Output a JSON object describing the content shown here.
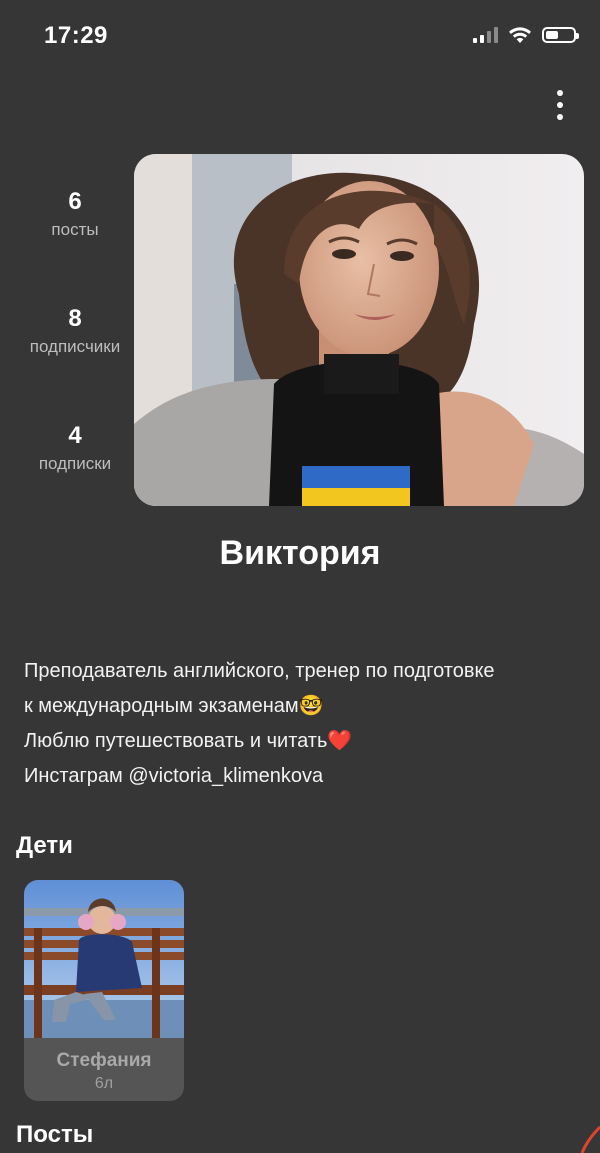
{
  "status_bar": {
    "time": "17:29",
    "signal_icon": "cellular-signal-icon",
    "wifi_icon": "wifi-icon",
    "battery_icon": "battery-icon",
    "battery_level": 0.4
  },
  "header": {
    "menu_icon": "more-vertical-icon"
  },
  "stats": [
    {
      "count": "6",
      "label": "посты"
    },
    {
      "count": "8",
      "label": "подписчики"
    },
    {
      "count": "4",
      "label": "подписки"
    }
  ],
  "profile": {
    "name": "Виктория",
    "bio_lines": [
      "Преподаватель английского, тренер по подготовке",
      "к международным экзаменам🤓",
      "Люблю путешествовать и читать❤️",
      "Инстаграм @victoria_klimenkova"
    ]
  },
  "children_section": {
    "title": "Дети",
    "children": [
      {
        "name": "Стефания",
        "age": "6л"
      }
    ]
  },
  "posts_section": {
    "title": "Посты"
  },
  "colors": {
    "background": "#363636",
    "text": "#ffffff",
    "muted": "#bdbdbd",
    "card": "#555555",
    "accent": "#e0452a"
  }
}
